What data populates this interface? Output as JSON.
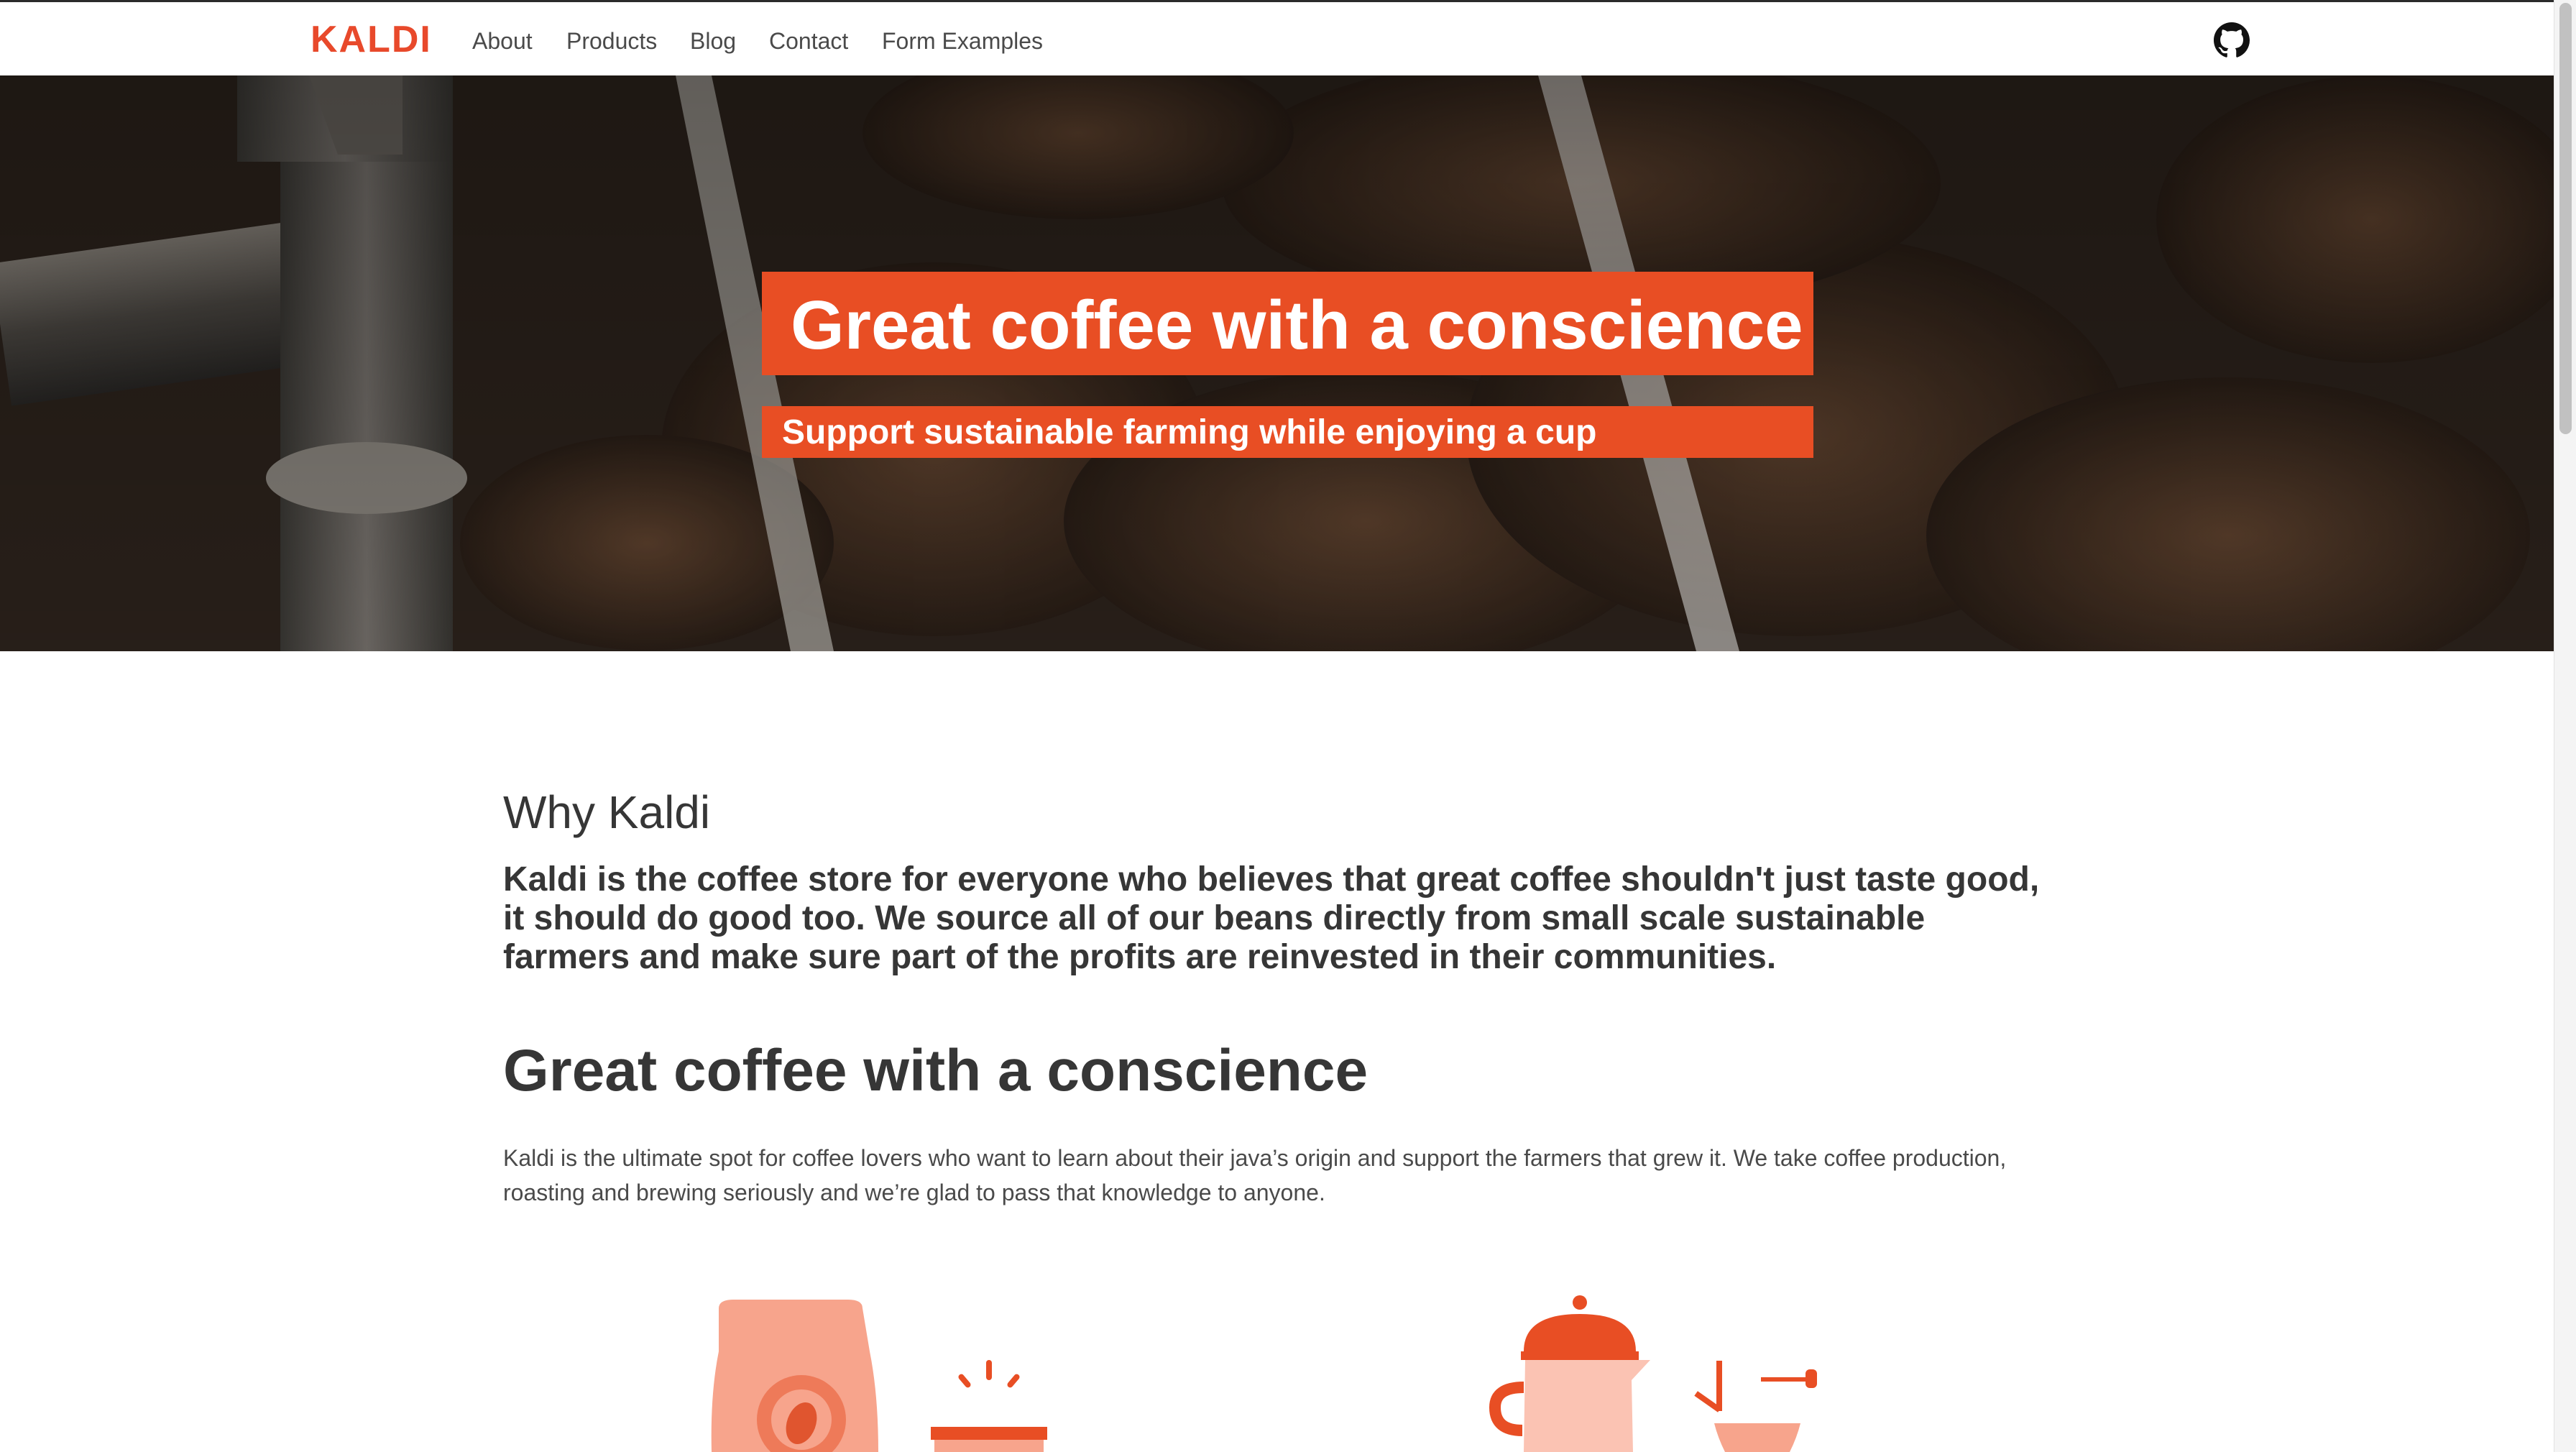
{
  "brand": {
    "logo": "KALDI",
    "accent_color": "#e84e24"
  },
  "nav": {
    "items": [
      {
        "label": "About"
      },
      {
        "label": "Products"
      },
      {
        "label": "Blog"
      },
      {
        "label": "Contact"
      },
      {
        "label": "Form Examples"
      }
    ],
    "github_icon": "github-icon"
  },
  "hero": {
    "title": "Great coffee with a conscience",
    "subtitle": "Support sustainable farming while enjoying a cup"
  },
  "intro": {
    "title": "Why Kaldi",
    "lead": "Kaldi is the coffee store for everyone who believes that great coffee shouldn't just taste good, it should do good too. We source all of our beans directly from small scale sustainable farmers and make sure part of the profits are reinvested in their communities."
  },
  "main": {
    "heading": "Great coffee with a conscience",
    "body": "Kaldi is the ultimate spot for coffee lovers who want to learn about their java’s origin and support the farmers that grew it. We take coffee production, roasting and brewing seriously and we’re glad to pass that knowledge to anyone."
  },
  "illustrations": [
    {
      "icon": "coffee-bag-icon"
    },
    {
      "icon": "coffee-pot-icon"
    }
  ]
}
